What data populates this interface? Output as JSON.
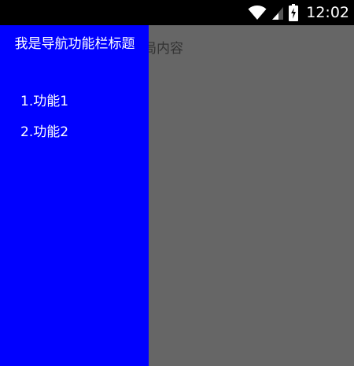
{
  "status_bar": {
    "time": "12:02",
    "icons": [
      "wifi-icon",
      "signal-icon",
      "battery-charging-icon"
    ]
  },
  "main": {
    "text": "我是主布局内容"
  },
  "drawer": {
    "title": "我是导航功能栏标题",
    "items": [
      {
        "label": "1.功能1"
      },
      {
        "label": "2.功能2"
      }
    ]
  },
  "colors": {
    "drawer_background": "#0000ff",
    "main_background": "#666666",
    "status_bar_background": "#000000",
    "drawer_text": "#ffffff",
    "main_text": "#333333"
  }
}
